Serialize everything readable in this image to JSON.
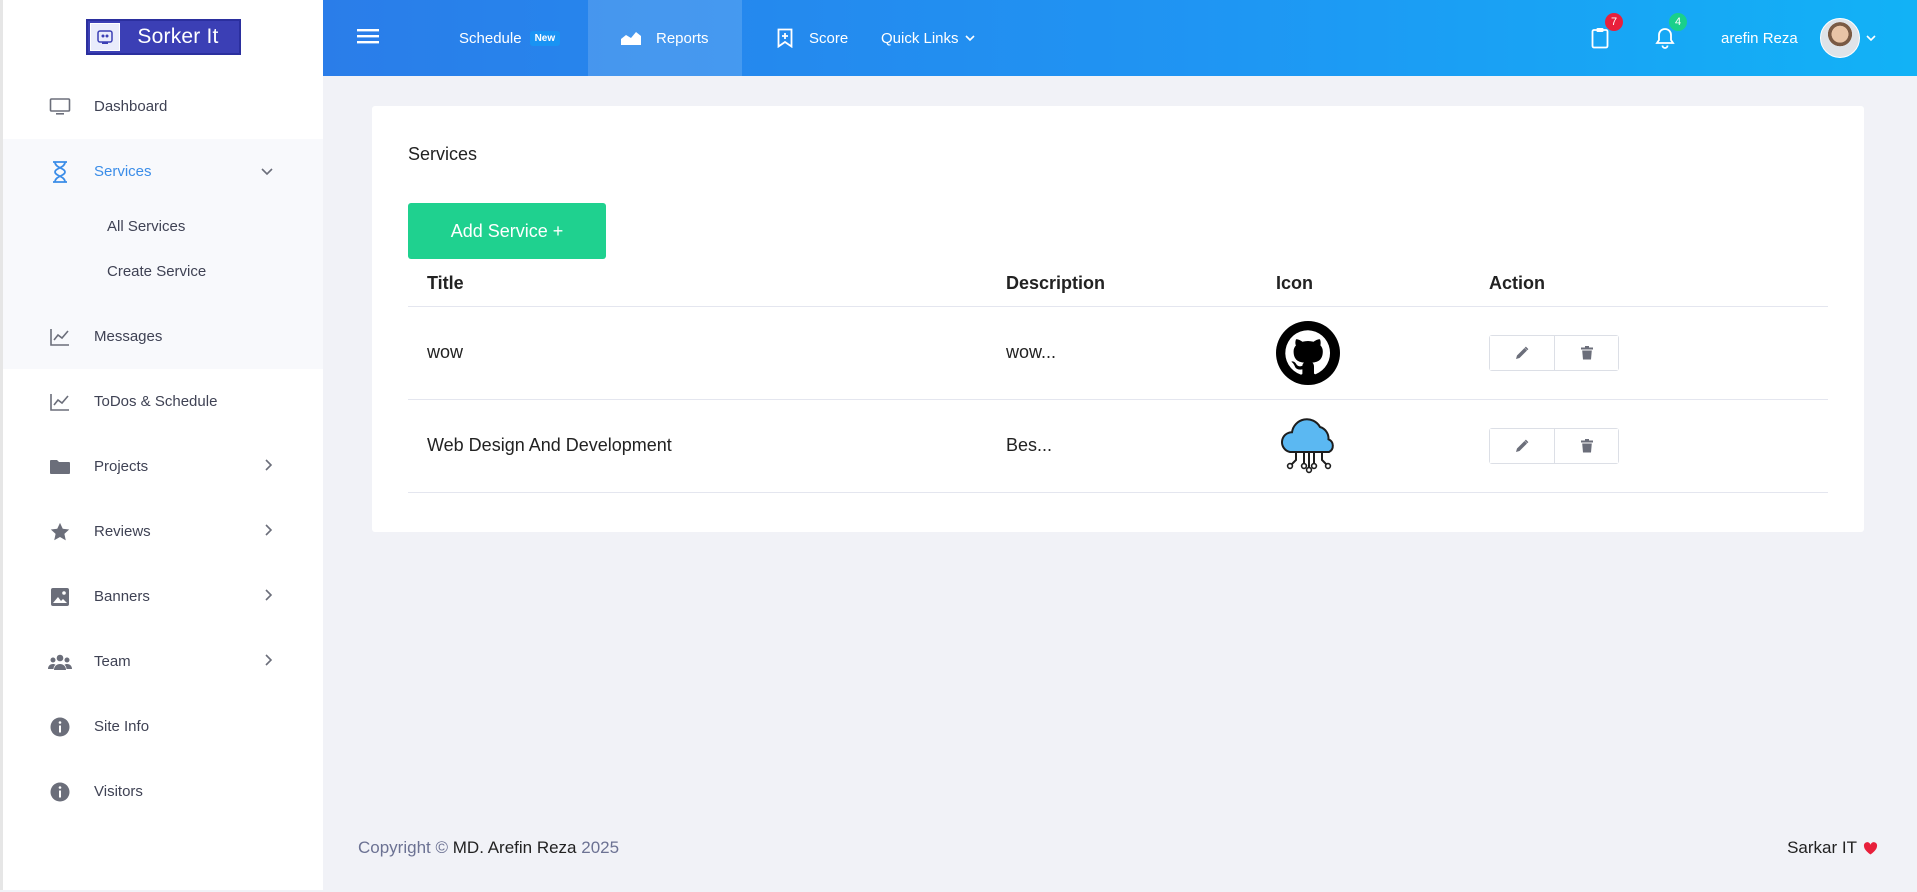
{
  "brand": {
    "name": "Sorker It"
  },
  "sidebar": {
    "items": [
      {
        "label": "Dashboard",
        "icon": "monitor-icon"
      },
      {
        "label": "Services",
        "icon": "hourglass-icon",
        "active": true,
        "children": [
          {
            "label": "All Services"
          },
          {
            "label": "Create Service"
          }
        ]
      },
      {
        "label": "Messages",
        "icon": "chart-line-icon"
      },
      {
        "label": "ToDos & Schedule",
        "icon": "chart-line-icon"
      },
      {
        "label": "Projects",
        "icon": "folder-icon"
      },
      {
        "label": "Reviews",
        "icon": "star-icon"
      },
      {
        "label": "Banners",
        "icon": "image-icon"
      },
      {
        "label": "Team",
        "icon": "users-icon"
      },
      {
        "label": "Site Info",
        "icon": "info-icon"
      },
      {
        "label": "Visitors",
        "icon": "info-icon"
      }
    ]
  },
  "topbar": {
    "schedule_label": "Schedule",
    "schedule_badge": "New",
    "reports_label": "Reports",
    "score_label": "Score",
    "quicklinks_label": "Quick Links",
    "clipboard_count": "7",
    "bell_count": "4",
    "user_name": "arefin Reza"
  },
  "page": {
    "title": "Services",
    "add_button": "Add Service +",
    "columns": [
      "Title",
      "Description",
      "Icon",
      "Action"
    ],
    "rows": [
      {
        "title": "wow",
        "description": "wow...",
        "icon": "github-icon"
      },
      {
        "title": "Web Design And Development",
        "description": "Bes...",
        "icon": "cloud-network-icon"
      }
    ]
  },
  "footer": {
    "copyright_prefix": "Copyright ©",
    "author": "MD. Arefin Reza",
    "year": "2025",
    "right_text": "Sarkar IT"
  },
  "colors": {
    "accent": "#3b8de8",
    "add_button": "#1fd18f",
    "badge_red": "#e8203b",
    "badge_green": "#1ad08a",
    "heart": "#e8203b"
  }
}
